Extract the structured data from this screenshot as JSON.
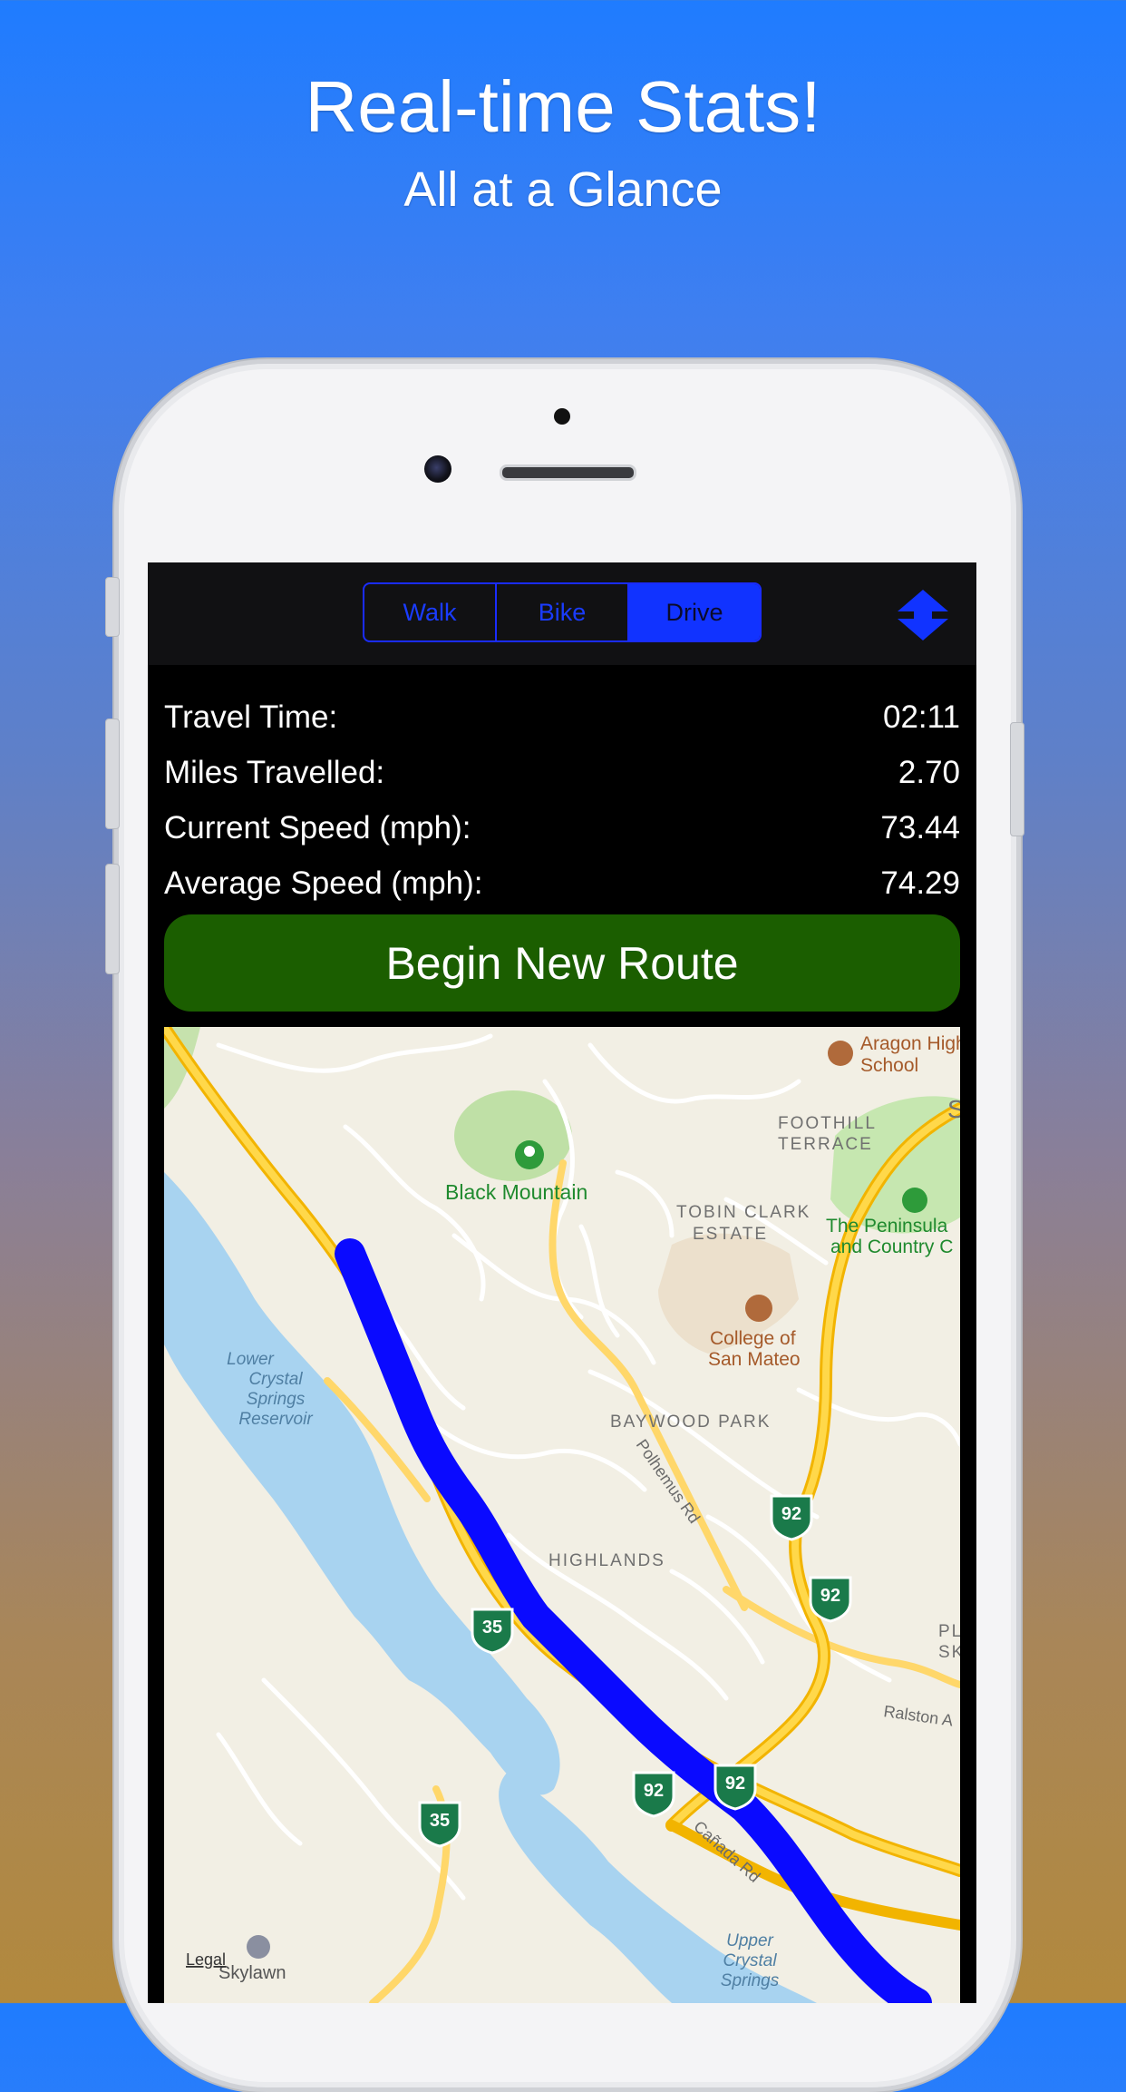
{
  "promo": {
    "title": "Real-time Stats!",
    "subtitle": "All at a Glance"
  },
  "toolbar": {
    "segments": [
      "Walk",
      "Bike",
      "Drive"
    ],
    "selected": "Drive",
    "accent_color": "#1133ff",
    "sort_icon": "up-down-arrow-icon"
  },
  "stats": [
    {
      "label": "Travel Time:",
      "value": "02:11"
    },
    {
      "label": "Miles Travelled:",
      "value": "2.70"
    },
    {
      "label": "Current Speed (mph):",
      "value": "73.44"
    },
    {
      "label": "Average Speed (mph):",
      "value": "74.29"
    }
  ],
  "begin_button": {
    "label": "Begin New Route",
    "color": "#1b5e00"
  },
  "map": {
    "route_color": "#0a0aff",
    "places": {
      "black_mountain": "Black Mountain",
      "aragon_1": "Aragon High",
      "aragon_2": "School",
      "foothill_1": "FOOTHILL",
      "foothill_2": "TERRACE",
      "tobin_1": "TOBIN CLARK",
      "tobin_2": "ESTATE",
      "peninsula_1": "The Peninsula",
      "peninsula_2": "and Country C",
      "college_1": "College of",
      "college_2": "San Mateo",
      "reservoir_1": "Lower",
      "reservoir_2": "Crystal",
      "reservoir_3": "Springs",
      "reservoir_4": "Reservoir",
      "baywood": "BAYWOOD PARK",
      "polhemus": "Polhemus Rd",
      "highlands": "HIGHLANDS",
      "plate_1": "PLATE",
      "plate_2": "SKYM",
      "ralston": "Ralston A",
      "canada": "Cañada Rd",
      "upper_1": "Upper",
      "upper_2": "Crystal",
      "upper_3": "Springs",
      "skylawn": "Skylawn",
      "legal": "Legal",
      "edge_s": "S"
    },
    "shields": [
      "92",
      "92",
      "92",
      "92",
      "35",
      "35"
    ]
  }
}
